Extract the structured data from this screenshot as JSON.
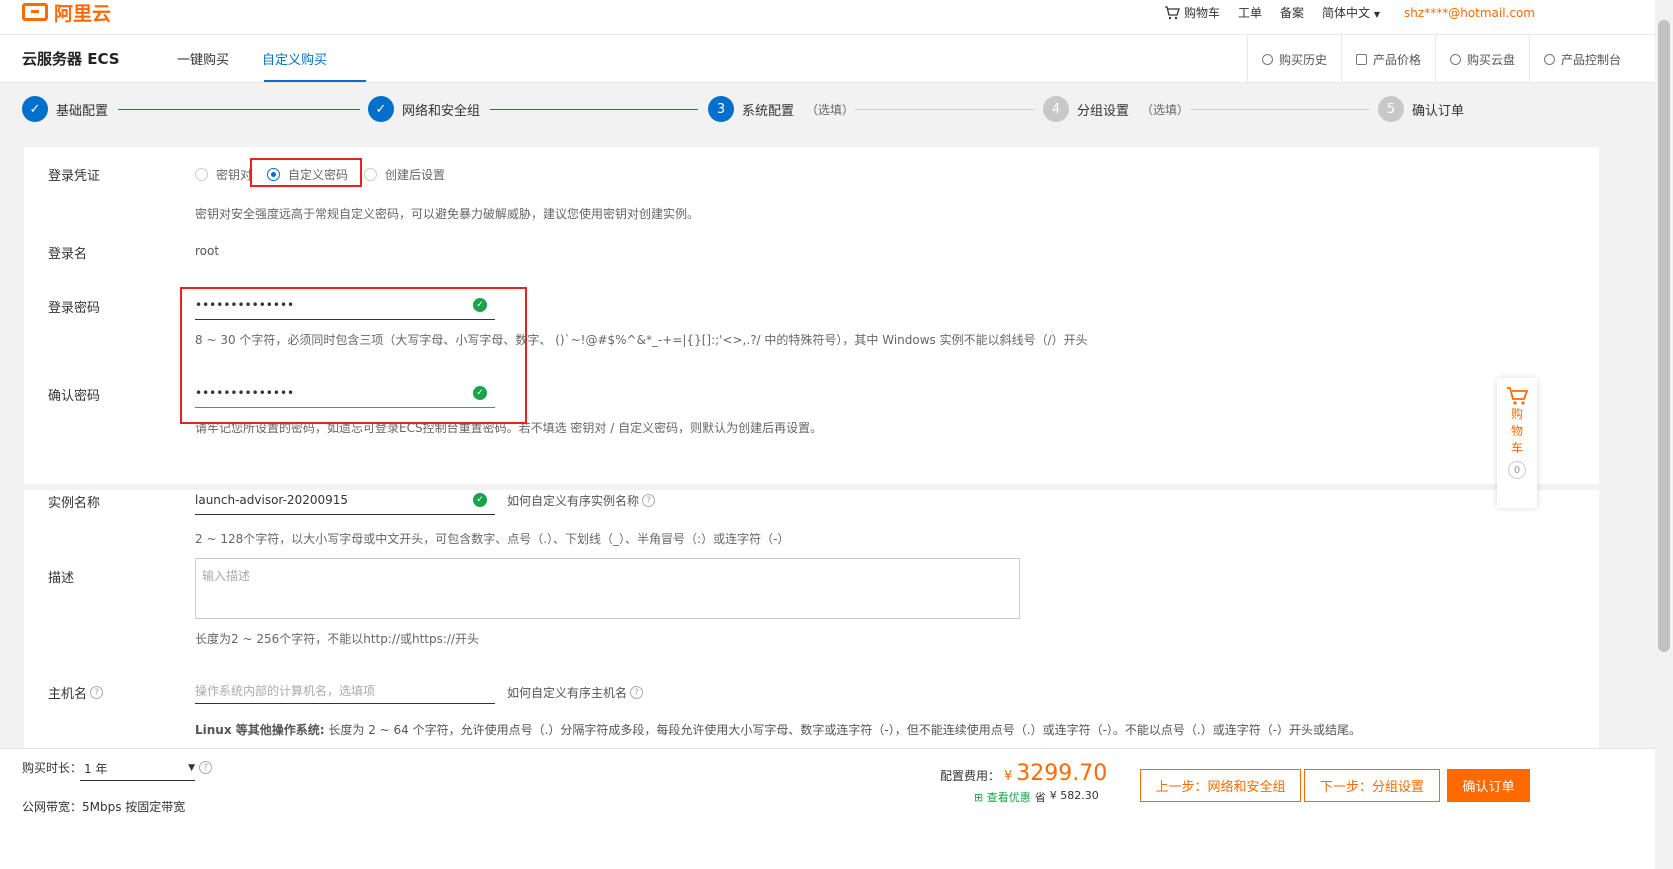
{
  "topbar": {
    "logo": "阿里云",
    "cart": "购物车",
    "ticket": "工单",
    "record": "备案",
    "language": "简体中文",
    "user_email": "shz****@hotmail.com"
  },
  "product": {
    "title": "云服务器 ECS",
    "tabs": [
      "一键购买",
      "自定义购买"
    ],
    "active_tab": "自定义购买",
    "quicklinks": [
      "购买历史",
      "产品价格",
      "购买云盘",
      "产品控制台"
    ]
  },
  "steps": [
    {
      "index": "✓",
      "label": "基础配置",
      "optional": "",
      "state": "done"
    },
    {
      "index": "✓",
      "label": "网络和安全组",
      "optional": "",
      "state": "done"
    },
    {
      "index": "3",
      "label": "系统配置",
      "optional": "（选填）",
      "state": "current"
    },
    {
      "index": "4",
      "label": "分组设置",
      "optional": "（选填）",
      "state": "todo"
    },
    {
      "index": "5",
      "label": "确认订单",
      "optional": "",
      "state": "todo"
    }
  ],
  "login": {
    "credential_label": "登录凭证",
    "options": [
      "密钥对",
      "自定义密码",
      "创建后设置"
    ],
    "selected": "自定义密码",
    "credential_hint": "密钥对安全强度远高于常规自定义密码，可以避免暴力破解威胁，建议您使用密钥对创建实例。",
    "name_label": "登录名",
    "name_value": "root",
    "password_label": "登录密码",
    "password_value": "••••••••••••••",
    "password_hint": "8 ~ 30 个字符，必须同时包含三项（大写字母、小写字母、数字、 ()`~!@#$%^&*_-+=|{}[]:;'<>,.?/ 中的特殊符号），其中 Windows 实例不能以斜线号（/）开头",
    "confirm_label": "确认密码",
    "confirm_value": "••••••••••••••",
    "confirm_hint": "请牢记您所设置的密码，如遗忘可登录ECS控制台重置密码。若不填选 密钥对 / 自定义密码，则默认为创建后再设置。"
  },
  "instance": {
    "name_label": "实例名称",
    "name_value": "launch-advisor-20200915",
    "name_help": "如何自定义有序实例名称",
    "name_hint": "2 ~ 128个字符，以大小写字母或中文开头，可包含数字、点号（.）、下划线（_）、半角冒号（:）或连字符（-）",
    "desc_label": "描述",
    "desc_placeholder": "输入描述",
    "desc_hint": "长度为2 ~ 256个字符，不能以http://或https://开头",
    "host_label": "主机名",
    "host_placeholder": "操作系统内部的计算机名，选填项",
    "host_help": "如何自定义有序主机名",
    "host_hint_bold": "Linux 等其他操作系统:",
    "host_hint": " 长度为 2 ~ 64 个字符，允许使用点号（.）分隔字符成多段，每段允许使用大小写字母、数字或连字符（-），但不能连续使用点号（.）或连字符（-）。不能以点号（.）或连字符（-）开头或结尾。"
  },
  "bottom": {
    "duration_label": "购买时长：",
    "duration_value": "1 年",
    "bandwidth_label": "公网带宽：",
    "bandwidth_value": "5Mbps 按固定带宽",
    "fee_label": "配置费用：",
    "currency": "¥",
    "fee_value": "3299.70",
    "discount_link": "查看优惠",
    "save_label": "省",
    "save_value": "¥ 582.30",
    "prev_button": "上一步：网络和安全组",
    "next_button": "下一步：分组设置",
    "confirm_button": "确认订单"
  },
  "sidecart": {
    "label_chars": [
      "购",
      "物",
      "车"
    ],
    "count": "0"
  },
  "colors": {
    "accent": "#ff6a00",
    "primary": "#0070cc",
    "success": "#1aa34a",
    "highlight": "#e52420"
  }
}
